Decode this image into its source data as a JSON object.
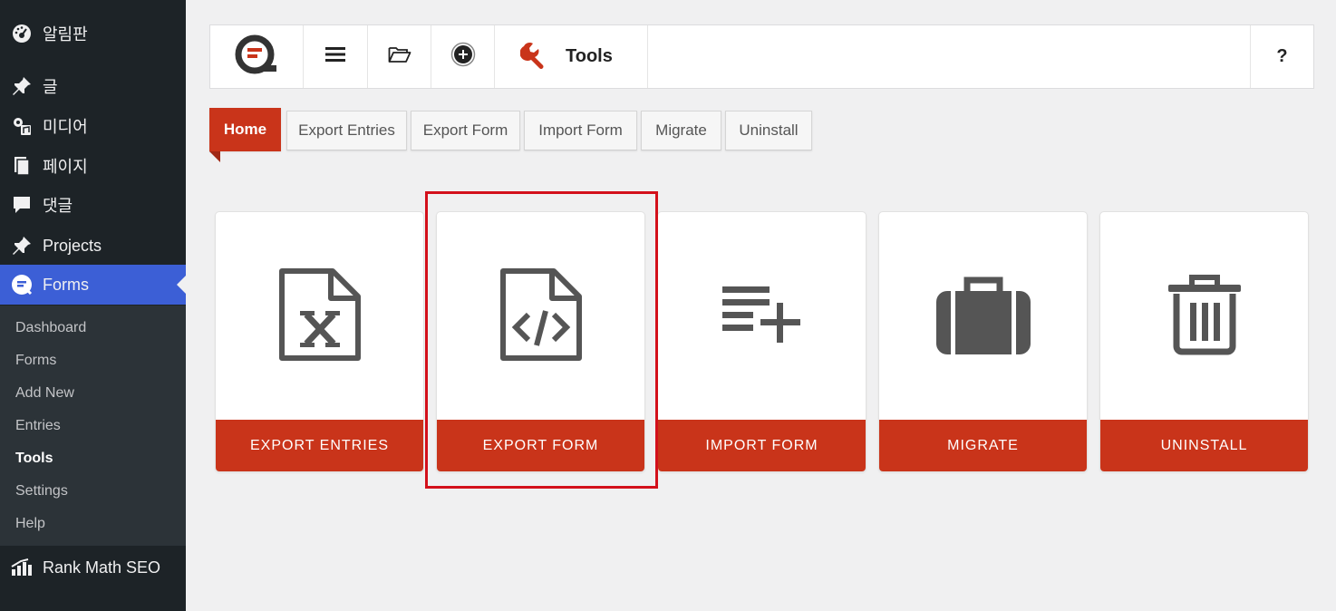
{
  "sidebar": {
    "menu": [
      {
        "label": "알림판",
        "icon": "dashboard-icon"
      },
      {
        "label": "글",
        "icon": "pin-icon"
      },
      {
        "label": "미디어",
        "icon": "media-icon"
      },
      {
        "label": "페이지",
        "icon": "pages-icon"
      },
      {
        "label": "댓글",
        "icon": "comments-icon"
      },
      {
        "label": "Projects",
        "icon": "pin-icon"
      },
      {
        "label": "Forms",
        "icon": "forms-icon"
      },
      {
        "label": "Rank Math SEO",
        "icon": "rank-math-icon"
      }
    ],
    "submenu": [
      "Dashboard",
      "Forms",
      "Add New",
      "Entries",
      "Tools",
      "Settings",
      "Help"
    ],
    "current_submenu": "Tools"
  },
  "topbar": {
    "title": "Tools",
    "help": "?",
    "icons": [
      "formidable-logo-icon",
      "menu-icon",
      "folder-icon",
      "add-circle-icon",
      "wrench-icon"
    ]
  },
  "tabs": [
    "Home",
    "Export Entries",
    "Export Form",
    "Import Form",
    "Migrate",
    "Uninstall"
  ],
  "active_tab": "Home",
  "cards": [
    {
      "label": "EXPORT ENTRIES",
      "icon": "excel-file-icon"
    },
    {
      "label": "EXPORT FORM",
      "icon": "code-file-icon"
    },
    {
      "label": "IMPORT FORM",
      "icon": "list-add-icon"
    },
    {
      "label": "MIGRATE",
      "icon": "briefcase-icon"
    },
    {
      "label": "UNINSTALL",
      "icon": "trash-icon"
    }
  ],
  "colors": {
    "accent": "#c9341a",
    "sidebar": "#1d2327",
    "active_menu": "#3c5fd6",
    "highlight": "#d3101b"
  }
}
